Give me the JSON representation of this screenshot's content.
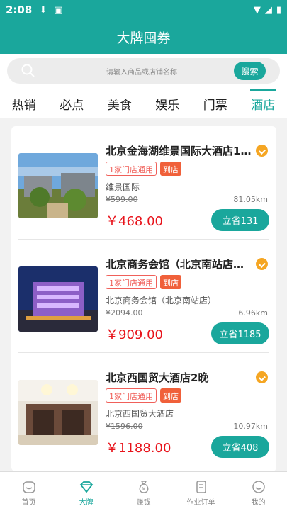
{
  "status_bar": {
    "time": "2:08"
  },
  "header": {
    "title": "大牌囤券"
  },
  "search": {
    "placeholder": "请输入商品或店铺名称",
    "button_label": "搜索"
  },
  "tabs": [
    {
      "label": "热销",
      "active": false
    },
    {
      "label": "必点",
      "active": false
    },
    {
      "label": "美食",
      "active": false
    },
    {
      "label": "娱乐",
      "active": false
    },
    {
      "label": "门票",
      "active": false
    },
    {
      "label": "酒店",
      "active": true
    }
  ],
  "items": [
    {
      "title": "北京金海湖维景国际大酒店1…",
      "tag_outline": "1家门店通用",
      "tag_fill": "到店",
      "store": "维景国际",
      "original_price": "¥599.00",
      "distance": "81.05km",
      "price": "￥468.00",
      "save_label": "立省131"
    },
    {
      "title": "北京商务会馆（北京南站店…",
      "tag_outline": "1家门店通用",
      "tag_fill": "到店",
      "store": "北京商务会馆（北京南站店）",
      "original_price": "¥2094.00",
      "distance": "6.96km",
      "price": "￥909.00",
      "save_label": "立省1185"
    },
    {
      "title": "北京西国贸大酒店2晚",
      "tag_outline": "1家门店通用",
      "tag_fill": "到店",
      "store": "北京西国贸大酒店",
      "original_price": "¥1596.00",
      "distance": "10.97km",
      "price": "￥1188.00",
      "save_label": "立省408"
    }
  ],
  "tabbar": [
    {
      "label": "首页",
      "icon": "home-icon",
      "active": false
    },
    {
      "label": "大牌",
      "icon": "diamond-icon",
      "active": true
    },
    {
      "label": "赚钱",
      "icon": "money-bag-icon",
      "active": false
    },
    {
      "label": "作业订单",
      "icon": "document-icon",
      "active": false
    },
    {
      "label": "我的",
      "icon": "profile-face-icon",
      "active": false
    }
  ],
  "colors": {
    "primary": "#1aa79c",
    "price_red": "#e8131b",
    "tag_red": "#f0605a",
    "badge_orange": "#f5a623"
  }
}
